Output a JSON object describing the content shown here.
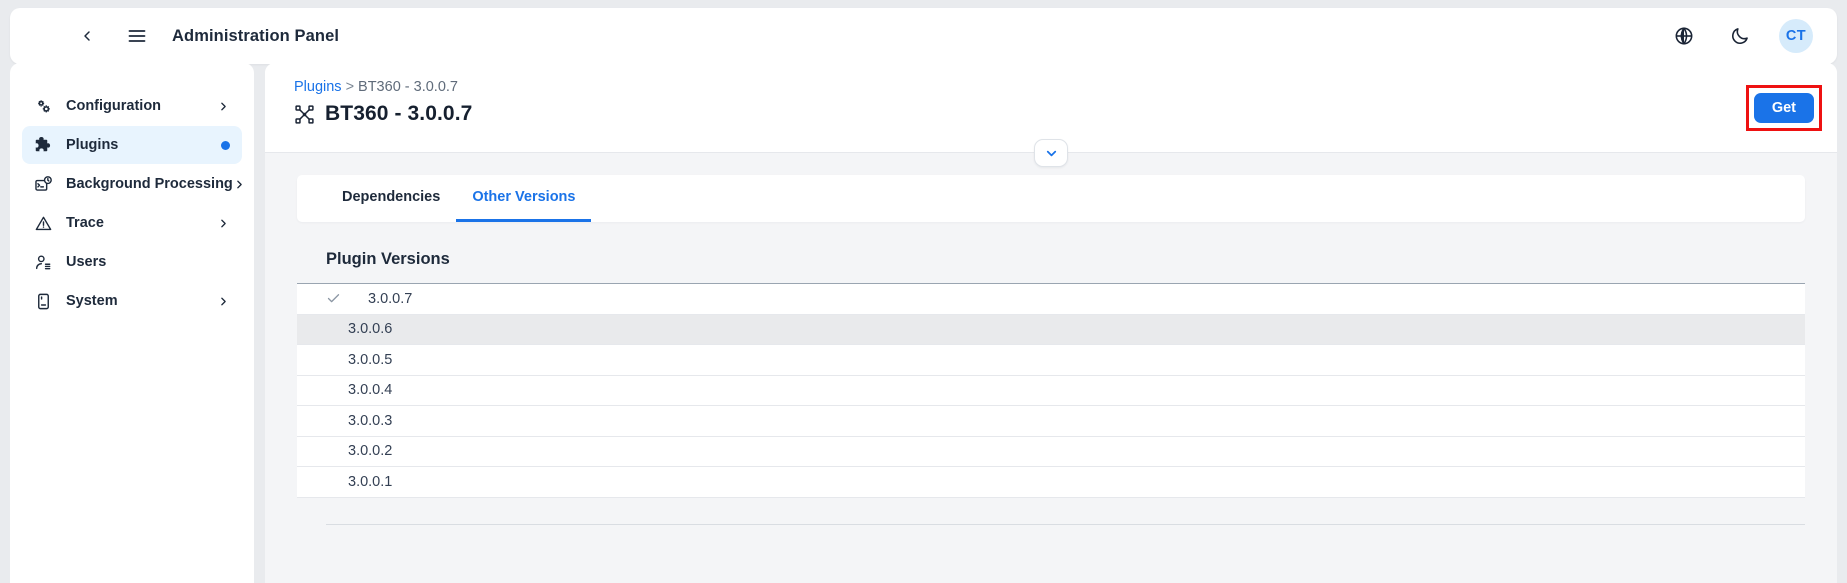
{
  "topbar": {
    "back_icon": "chevron-left-icon",
    "menu_icon": "hamburger-menu-icon",
    "title": "Administration Panel",
    "globe_icon": "globe-icon",
    "theme_icon": "moon-icon",
    "avatar_initials": "CT"
  },
  "sidebar": {
    "items": [
      {
        "label": "Configuration",
        "icon": "gears-icon",
        "tail": "chevron",
        "active": false
      },
      {
        "label": "Plugins",
        "icon": "puzzle-piece-icon",
        "tail": "dot",
        "active": true
      },
      {
        "label": "Background Processing",
        "icon": "background-processing-icon",
        "tail": "chevron",
        "active": false
      },
      {
        "label": "Trace",
        "icon": "warning-triangle-icon",
        "tail": "chevron",
        "active": false
      },
      {
        "label": "Users",
        "icon": "user-list-icon",
        "tail": "none",
        "active": false
      },
      {
        "label": "System",
        "icon": "device-icon",
        "tail": "chevron",
        "active": false
      }
    ]
  },
  "page": {
    "breadcrumb_root": "Plugins",
    "breadcrumb_separator": ">",
    "breadcrumb_current": "BT360 - 3.0.0.7",
    "title": "BT360 - 3.0.0.7",
    "title_icon": "plugin-network-icon",
    "get_label": "Get",
    "collapse_icon": "chevron-down-icon"
  },
  "tabs": [
    {
      "label": "Dependencies",
      "active": false
    },
    {
      "label": "Other Versions",
      "active": true
    }
  ],
  "versions_section": {
    "heading": "Plugin Versions",
    "rows": [
      {
        "version": "3.0.0.7",
        "selected": true,
        "hover": false
      },
      {
        "version": "3.0.0.6",
        "selected": false,
        "hover": true
      },
      {
        "version": "3.0.0.5",
        "selected": false,
        "hover": false
      },
      {
        "version": "3.0.0.4",
        "selected": false,
        "hover": false
      },
      {
        "version": "3.0.0.3",
        "selected": false,
        "hover": false
      },
      {
        "version": "3.0.0.2",
        "selected": false,
        "hover": false
      },
      {
        "version": "3.0.0.1",
        "selected": false,
        "hover": false
      }
    ]
  },
  "colors": {
    "accent": "#1a73e8",
    "highlight_border": "#ee1111",
    "text_dark": "#1e2a3b",
    "page_bg": "#e9ebee",
    "panel_bg": "#f4f5f7",
    "active_nav_bg": "#e8f4fe",
    "row_hover_bg": "#e9eaec"
  }
}
